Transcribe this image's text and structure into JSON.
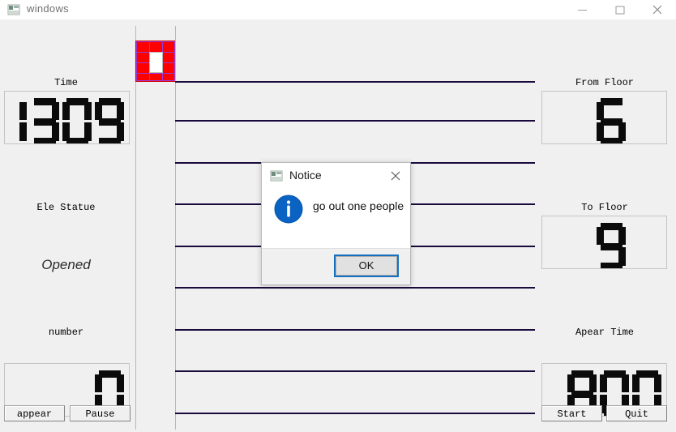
{
  "window": {
    "title": "windows",
    "icon": "app-window-icon",
    "controls": {
      "minimize": "minimize-icon",
      "maximize": "maximize-icon",
      "close": "close-icon"
    }
  },
  "left_panel": {
    "time": {
      "label": "Time",
      "value": "1309"
    },
    "status": {
      "label": "Ele Statue",
      "value": "Opened"
    },
    "number": {
      "label": "number",
      "value": "0"
    },
    "buttons": {
      "appear": "appear",
      "pause": "Pause"
    }
  },
  "right_panel": {
    "from_floor": {
      "label": "From Floor",
      "value": "6"
    },
    "to_floor": {
      "label": "To Floor",
      "value": "9"
    },
    "apear_time": {
      "label": "Apear Time",
      "value": "800"
    },
    "buttons": {
      "start": "Start",
      "quit": "Quit"
    }
  },
  "building": {
    "floor_count": 9,
    "car_position_floor": 9,
    "shaft_color": "#c9a6e0",
    "floor_line_color": "#1a0a3c",
    "car_color": "#fe0000"
  },
  "dialog": {
    "title": "Notice",
    "title_icon": "app-window-icon",
    "icon": "info-icon",
    "message": "go out one people",
    "ok_label": "OK",
    "close_icon": "close-icon",
    "accent": "#1570c0"
  }
}
